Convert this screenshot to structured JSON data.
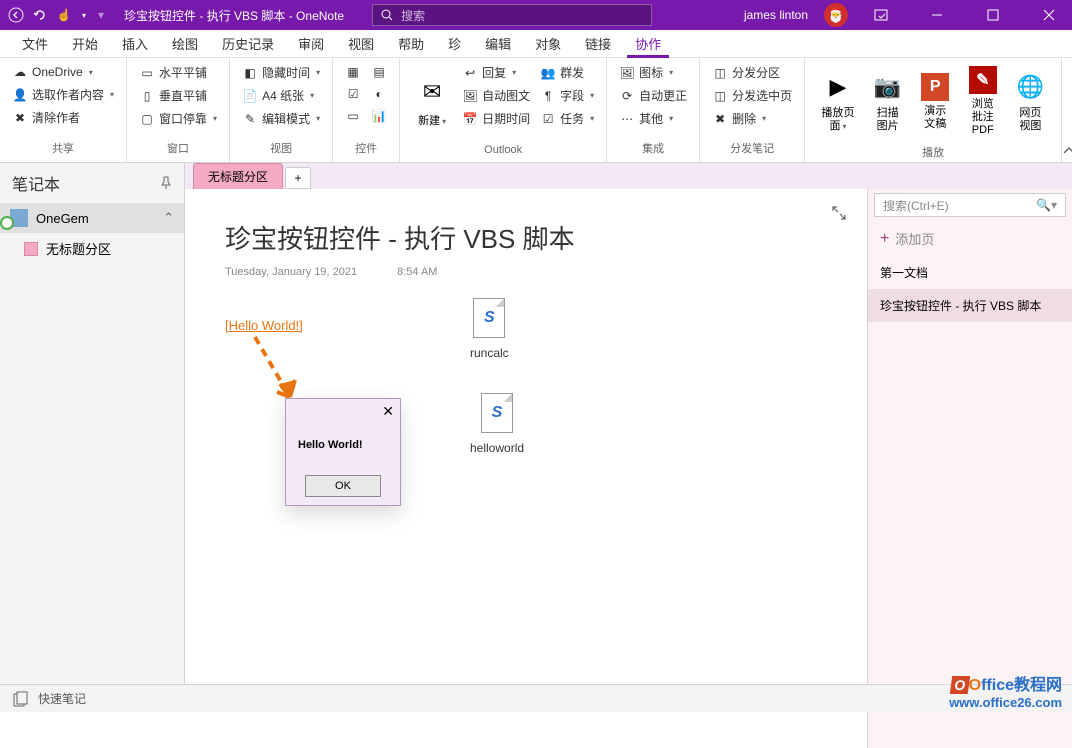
{
  "titlebar": {
    "title": "珍宝按钮控件 - 执行 VBS 脚本  -  OneNote",
    "search_placeholder": "搜索",
    "user": "james linton"
  },
  "tabs": [
    "文件",
    "开始",
    "插入",
    "绘图",
    "历史记录",
    "审阅",
    "视图",
    "帮助",
    "珍",
    "编辑",
    "对象",
    "链接",
    "协作"
  ],
  "active_tab": 12,
  "ribbon": {
    "groups": [
      {
        "label": "共享",
        "items": [
          {
            "icon": "☁",
            "text": "OneDrive",
            "caret": true
          },
          {
            "icon": "👤",
            "text": "选取作者内容",
            "caret": true
          },
          {
            "icon": "✖",
            "text": "清除作者"
          }
        ]
      },
      {
        "label": "窗口",
        "items": [
          {
            "icon": "▭",
            "text": "水平平铺"
          },
          {
            "icon": "▯",
            "text": "垂直平铺"
          },
          {
            "icon": "▢",
            "text": "窗口停靠",
            "caret": true
          }
        ]
      },
      {
        "label": "视图",
        "items": [
          {
            "icon": "◧",
            "text": "隐藏时间",
            "caret": true
          },
          {
            "icon": "📄",
            "text": "A4 纸张",
            "caret": true
          },
          {
            "icon": "✎",
            "text": "编辑模式",
            "caret": true
          }
        ]
      },
      {
        "label": "控件",
        "icons_only": true
      },
      {
        "label": "Outlook",
        "big": {
          "icon": "✉",
          "text": "新建",
          "caret": true
        },
        "items": [
          {
            "icon": "↩",
            "text": "回复",
            "caret": true
          },
          {
            "icon": "🖼",
            "text": "自动图文"
          },
          {
            "icon": "📅",
            "text": "日期时间"
          }
        ],
        "items2": [
          {
            "icon": "👥",
            "text": "群发"
          },
          {
            "icon": "¶",
            "text": "字段",
            "caret": true
          },
          {
            "icon": "☑",
            "text": "任务",
            "caret": true
          }
        ]
      },
      {
        "label": "集成",
        "items": [
          {
            "icon": "🖼",
            "text": "图标",
            "caret": true
          },
          {
            "icon": "⟳",
            "text": "自动更正"
          },
          {
            "icon": "⋯",
            "text": "其他",
            "caret": true
          }
        ]
      },
      {
        "label": "分发笔记",
        "items": [
          {
            "icon": "◫",
            "text": "分发分区"
          },
          {
            "icon": "◫",
            "text": "分发选中页"
          },
          {
            "icon": "✖",
            "text": "删除",
            "caret": true
          }
        ]
      },
      {
        "label": "播放",
        "large_buttons": [
          {
            "icon": "▶",
            "text": "播放页面",
            "caret": true
          },
          {
            "icon": "📷",
            "text": "扫描图片"
          },
          {
            "icon": "P",
            "text": "演示文稿",
            "bg": "#d24726"
          },
          {
            "icon": "✎",
            "text": "浏览批注 PDF",
            "bg": "#b30b00"
          },
          {
            "icon": "🌐",
            "text": "网页视图"
          }
        ]
      }
    ]
  },
  "sidebar": {
    "header": "笔记本",
    "notebook": "OneGem",
    "section": "无标题分区"
  },
  "section_tab": "无标题分区",
  "page": {
    "title": "珍宝按钮控件 - 执行 VBS 脚本",
    "date": "Tuesday, January 19, 2021",
    "time": "8:54 AM",
    "link": "[Hello World!]",
    "file1": "runcalc",
    "file2": "helloworld"
  },
  "msgbox": {
    "text": "Hello World!",
    "ok": "OK"
  },
  "pages_panel": {
    "search": "搜索(Ctrl+E)",
    "add": "添加页",
    "entries": [
      "第一文档",
      "珍宝按钮控件 - 执行 VBS 脚本"
    ]
  },
  "statusbar": {
    "text": "快速笔记"
  },
  "watermark": {
    "title_rest": "ffice教程网",
    "url": "www.office26.com"
  }
}
